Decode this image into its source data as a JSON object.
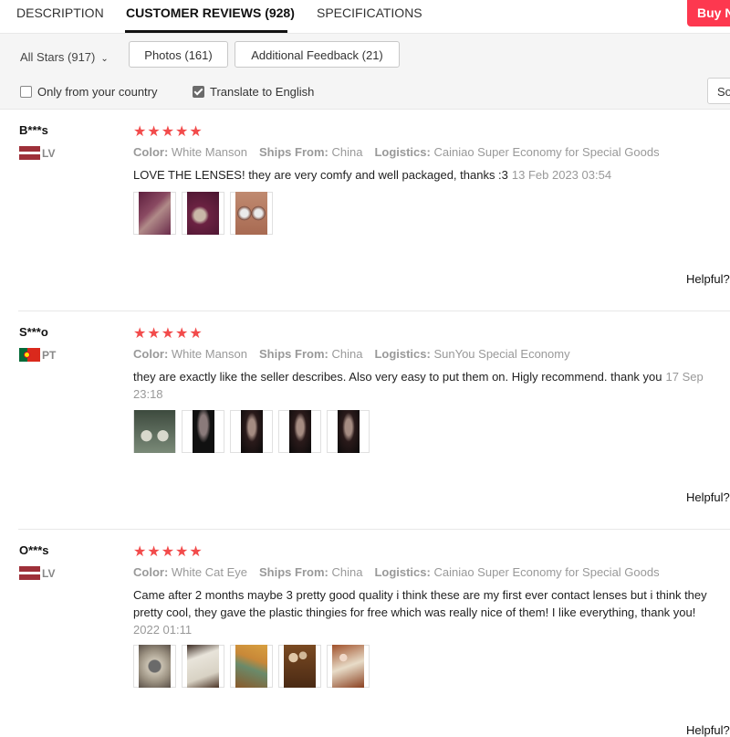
{
  "tabs": {
    "description": "DESCRIPTION",
    "reviews": "CUSTOMER REVIEWS (928)",
    "specifications": "SPECIFICATIONS",
    "buy_now": "Buy N"
  },
  "filters": {
    "stars": "All Stars (917)",
    "photos": "Photos (161)",
    "feedback": "Additional Feedback (21)",
    "only_country": "Only from your country",
    "only_country_checked": false,
    "translate": "Translate to English",
    "translate_checked": true,
    "sort": "So"
  },
  "labels": {
    "color": "Color:",
    "ships_from": "Ships From:",
    "logistics": "Logistics:",
    "helpful": "Helpful?"
  },
  "colors": {
    "star": "#f24b4b",
    "buy": "#fd384f"
  },
  "reviews": [
    {
      "name": "B***s",
      "country": "LV",
      "flag": "latvia-flag",
      "stars": "★★★★★",
      "rating": 5,
      "color": "White Manson",
      "ships_from": "China",
      "logistics": "Cainiao Super Economy for Special Goods",
      "text": "LOVE THE LENSES! they are very comfy and well packaged, thanks :3",
      "date": "13 Feb 2023 03:54",
      "thumb_count": 3
    },
    {
      "name": "S***o",
      "country": "PT",
      "flag": "portugal-flag",
      "stars": "★★★★★",
      "rating": 5,
      "color": "White Manson",
      "ships_from": "China",
      "logistics": "SunYou Special Economy",
      "text": "they are exactly like the seller describes. Also very easy to put them on. Higly recommend. thank you",
      "date": "17 Sep",
      "date2": "23:18",
      "thumb_count": 5
    },
    {
      "name": "O***s",
      "country": "LV",
      "flag": "latvia-flag",
      "stars": "★★★★★",
      "rating": 5,
      "color": "White Cat Eye",
      "ships_from": "China",
      "logistics": "Cainiao Super Economy for Special Goods",
      "text1": "Came after 2 months maybe 3 pretty good quality i think these are my first ever contact lenses but i think they",
      "text2": "pretty cool, they gave the plastic thingies for free which was really nice of them! I like everything, thank you!",
      "date": "2022 01:11",
      "thumb_count": 5
    }
  ]
}
